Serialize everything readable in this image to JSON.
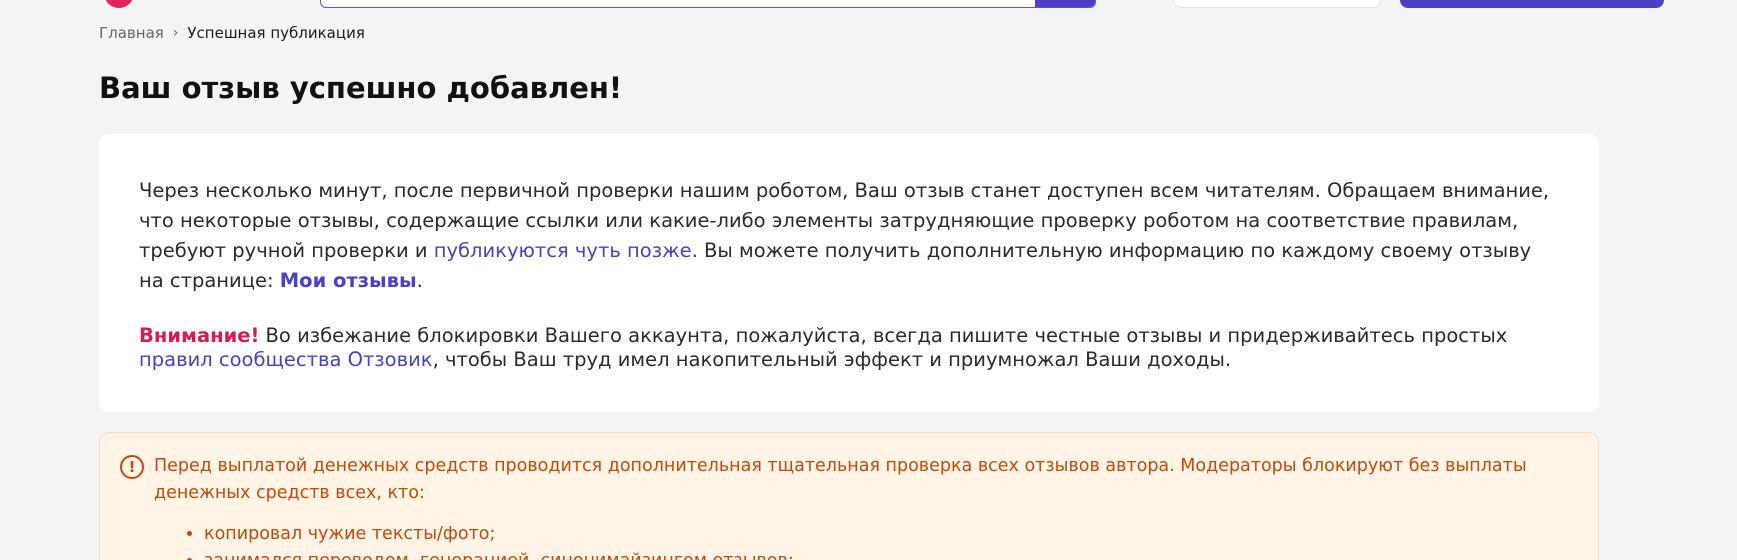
{
  "breadcrumb": {
    "home": "Главная",
    "separator": "›",
    "current": "Успешная публикация"
  },
  "title": "Ваш отзыв успешно добавлен!",
  "info": {
    "text_1": "Через несколько минут, после первичной проверки нашим роботом, Ваш отзыв станет доступен всем читателям. Обращаем внимание, что некоторые отзывы, содержащие ссылки или какие-либо элементы затрудняющие проверку роботом на соответствие правилам, требуют ручной проверки и ",
    "link_later": "публикуются чуть позже",
    "text_2": ". Вы можете получить дополнительную информацию по каждому своему отзыву на странице: ",
    "link_my_reviews": "Мои отзывы",
    "text_3": "."
  },
  "warning": {
    "label": "Внимание!",
    "text_1": " Во избежание блокировки Вашего аккаунта, пожалуйста, всегда пишите честные отзывы и придерживайтесь простых ",
    "link_rules": "правил сообщества Отзовик",
    "text_2": ", чтобы Ваш труд имел накопительный эффект и приумножал Ваши доходы."
  },
  "notice": {
    "icon": "exclamation-circle-icon",
    "text": "Перед выплатой денежных средств проводится дополнительная тщательная проверка всех отзывов автора. Модераторы блокируют без выплаты денежных средств всех, кто:",
    "items": [
      "копировал чужие тексты/фото;",
      "занимался переводом, генерацией, синонимайзингом отзывов;"
    ]
  },
  "colors": {
    "accent": "#4a40c8",
    "attention": "#d81b55",
    "notice_text": "#c44a0c",
    "notice_bg": "#fff4e6"
  }
}
